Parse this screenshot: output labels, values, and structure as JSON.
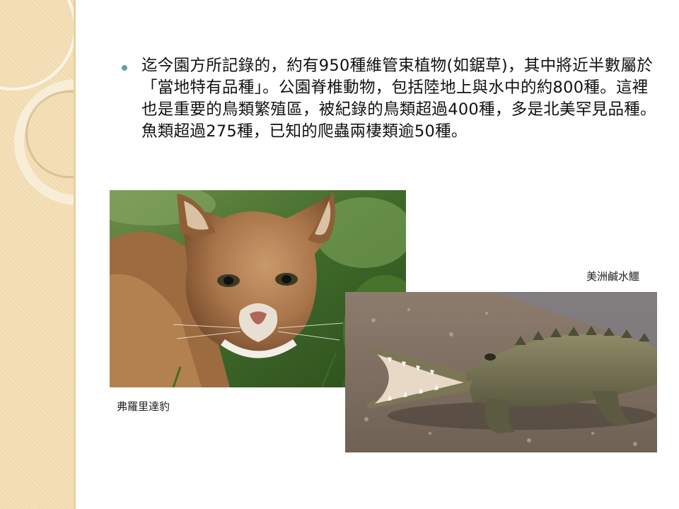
{
  "slide": {
    "bullet_text": "迄今園方所記錄的，約有950種維管束植物(如鋸草)，其中將近半數屬於「當地特有品種」。公園脊椎動物，包括陸地上與水中的約800種。這裡也是重要的鳥類繁殖區，被紀錄的鳥類超過400種，多是北美罕見品種。魚類超過275種，已知的爬蟲兩棲類逾50種。",
    "caption_cougar": "弗羅里達豹",
    "caption_croc": "美洲鹹水鱷"
  },
  "colors": {
    "sidebar": "#f3deb4",
    "bullet": "#5b9fb5",
    "text": "#111111"
  }
}
